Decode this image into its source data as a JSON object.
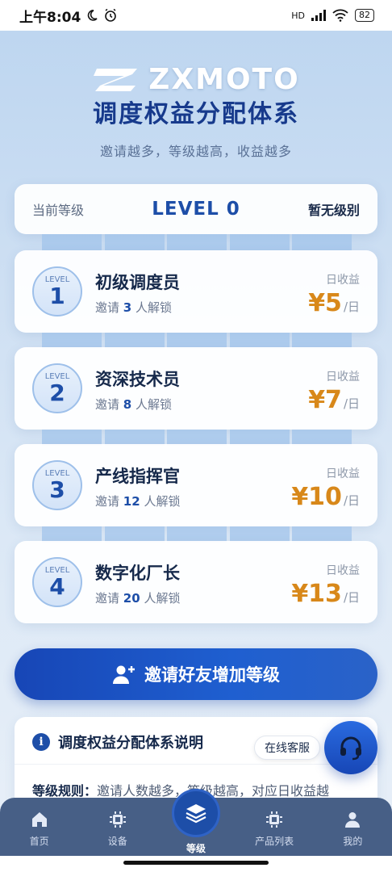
{
  "status_bar": {
    "time": "上午8:04",
    "battery": "82",
    "network": "HD"
  },
  "header": {
    "brand": "ZXMOTO",
    "title": "调度权益分配体系",
    "subtitle": "邀请越多，等级越高，收益越多"
  },
  "current": {
    "label": "当前等级",
    "level": "LEVEL 0",
    "grade": "暂无级别"
  },
  "levels": [
    {
      "badge_word": "LEVEL",
      "num": "1",
      "name": "初级调度员",
      "req_prefix": "邀请",
      "count": "3",
      "req_suffix": "人解锁",
      "income_label": "日收益",
      "amount": "¥5",
      "unit": "/日"
    },
    {
      "badge_word": "LEVEL",
      "num": "2",
      "name": "资深技术员",
      "req_prefix": "邀请",
      "count": "8",
      "req_suffix": "人解锁",
      "income_label": "日收益",
      "amount": "¥7",
      "unit": "/日"
    },
    {
      "badge_word": "LEVEL",
      "num": "3",
      "name": "产线指挥官",
      "req_prefix": "邀请",
      "count": "12",
      "req_suffix": "人解锁",
      "income_label": "日收益",
      "amount": "¥10",
      "unit": "/日"
    },
    {
      "badge_word": "LEVEL",
      "num": "4",
      "name": "数字化厂长",
      "req_prefix": "邀请",
      "count": "20",
      "req_suffix": "人解锁",
      "income_label": "日收益",
      "amount": "¥13",
      "unit": "/日"
    }
  ],
  "invite_button": {
    "label": "邀请好友增加等级"
  },
  "info": {
    "title": "调度权益分配体系说明",
    "rule_label": "等级规则：",
    "rule_text": "邀请人数越多，等级越高，对应日收益越"
  },
  "service": {
    "label": "在线客服"
  },
  "nav": {
    "items": [
      {
        "label": "首页",
        "icon": "home-icon"
      },
      {
        "label": "设备",
        "icon": "chip-icon"
      },
      {
        "label": "等级",
        "icon": "layers-icon"
      },
      {
        "label": "产品列表",
        "icon": "chip-icon"
      },
      {
        "label": "我的",
        "icon": "user-icon"
      }
    ]
  },
  "colors": {
    "brand_blue": "#1d4ea8",
    "income_orange": "#d8881a",
    "nav_bg": "#475f86"
  }
}
